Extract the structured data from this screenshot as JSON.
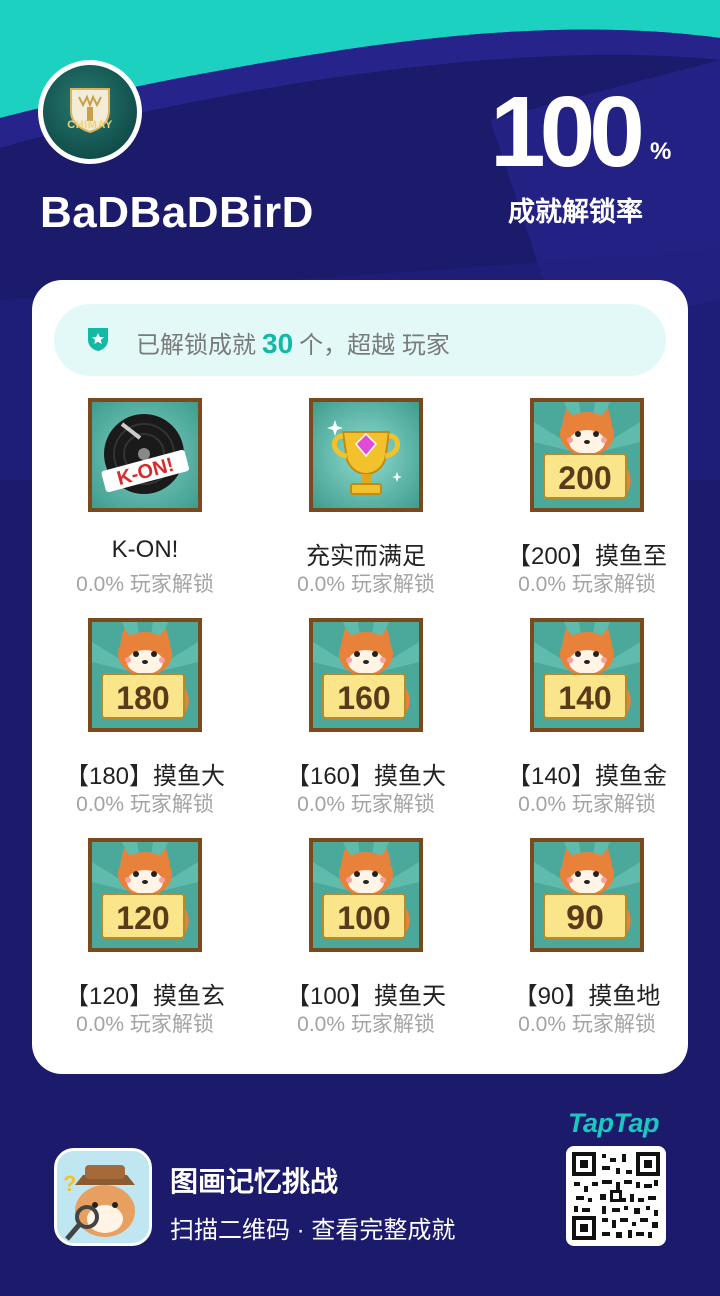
{
  "profile": {
    "avatar_text": "CHIMAY",
    "username": "BaDBaDBirD"
  },
  "stats": {
    "rate_value": "100",
    "rate_unit": "%",
    "rate_label": "成就解锁率"
  },
  "banner": {
    "prefix": "已解锁成就",
    "count": "30",
    "suffix": "个，超越  玩家"
  },
  "achievements": [
    {
      "name": "K-ON!",
      "sub": "0.0% 玩家解锁",
      "badge": "K-ON!",
      "icon": "vinyl-record-icon"
    },
    {
      "name": "充实而满足",
      "sub": "0.0% 玩家解锁",
      "badge": "",
      "icon": "trophy-icon"
    },
    {
      "name": "【200】摸鱼至",
      "sub": "0.0% 玩家解锁",
      "badge": "200",
      "icon": "shiba-sign-icon"
    },
    {
      "name": "【180】摸鱼大",
      "sub": "0.0% 玩家解锁",
      "badge": "180",
      "icon": "shiba-sign-icon"
    },
    {
      "name": "【160】摸鱼大",
      "sub": "0.0% 玩家解锁",
      "badge": "160",
      "icon": "shiba-sign-icon"
    },
    {
      "name": "【140】摸鱼金",
      "sub": "0.0% 玩家解锁",
      "badge": "140",
      "icon": "shiba-sign-icon"
    },
    {
      "name": "【120】摸鱼玄",
      "sub": "0.0% 玩家解锁",
      "badge": "120",
      "icon": "shiba-sign-icon"
    },
    {
      "name": "【100】摸鱼天",
      "sub": "0.0% 玩家解锁",
      "badge": "100",
      "icon": "shiba-sign-icon"
    },
    {
      "name": "【90】摸鱼地",
      "sub": "0.0% 玩家解锁",
      "badge": "90",
      "icon": "shiba-sign-icon"
    }
  ],
  "footer": {
    "app_title": "图画记忆挑战",
    "app_subtitle": "扫描二维码 · 查看完整成就",
    "brand": "TapTap"
  },
  "colors": {
    "background": "#1b1a6b",
    "accent": "#14b9a5",
    "teal_band": "#1dd1c0",
    "card": "#ffffff"
  }
}
